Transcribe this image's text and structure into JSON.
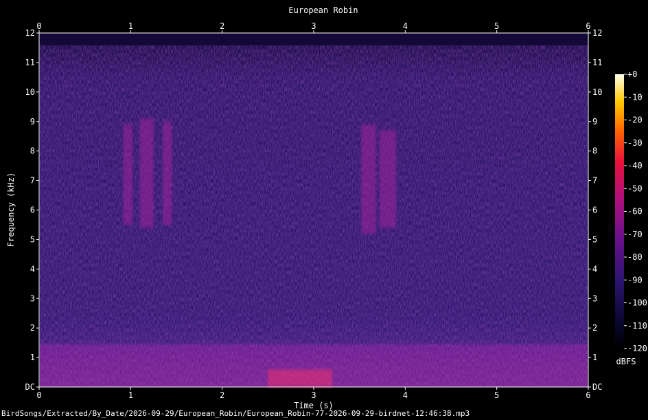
{
  "chart_data": {
    "type": "heatmap",
    "title": "European Robin",
    "xlabel": "Time (s)",
    "ylabel": "Frequency (kHz)",
    "xlim": [
      0,
      6
    ],
    "ylim": [
      0,
      12
    ],
    "x_ticks": [
      "0",
      "1",
      "2",
      "3",
      "4",
      "5",
      "6"
    ],
    "y_ticks": [
      "DC",
      "1",
      "2",
      "3",
      "4",
      "5",
      "6",
      "7",
      "8",
      "9",
      "10",
      "11",
      "12"
    ],
    "colorbar": {
      "label": "dBFS",
      "range": [
        -120,
        0
      ],
      "ticks": [
        "+0",
        "-10",
        "-20",
        "-30",
        "-40",
        "-50",
        "-60",
        "-70",
        "-80",
        "-90",
        "-100",
        "-110",
        "-120"
      ]
    },
    "events": [
      {
        "t_start": 0.92,
        "t_end": 1.02,
        "f_low": 5.5,
        "f_high": 8.9,
        "db": -72
      },
      {
        "t_start": 1.1,
        "t_end": 1.25,
        "f_low": 5.4,
        "f_high": 9.1,
        "db": -68
      },
      {
        "t_start": 1.35,
        "t_end": 1.45,
        "f_low": 5.5,
        "f_high": 9.0,
        "db": -74
      },
      {
        "t_start": 3.52,
        "t_end": 3.68,
        "f_low": 5.2,
        "f_high": 8.9,
        "db": -70
      },
      {
        "t_start": 3.72,
        "t_end": 3.9,
        "f_low": 5.4,
        "f_high": 8.7,
        "db": -70
      },
      {
        "t_start": 2.5,
        "t_end": 3.2,
        "f_low": 0.0,
        "f_high": 0.6,
        "db": -45
      }
    ]
  },
  "footer": {
    "filename": "BirdSongs/Extracted/By_Date/2026-09-29/European_Robin/European_Robin-77-2026-09-29-birdnet-12:46:38.mp3"
  }
}
